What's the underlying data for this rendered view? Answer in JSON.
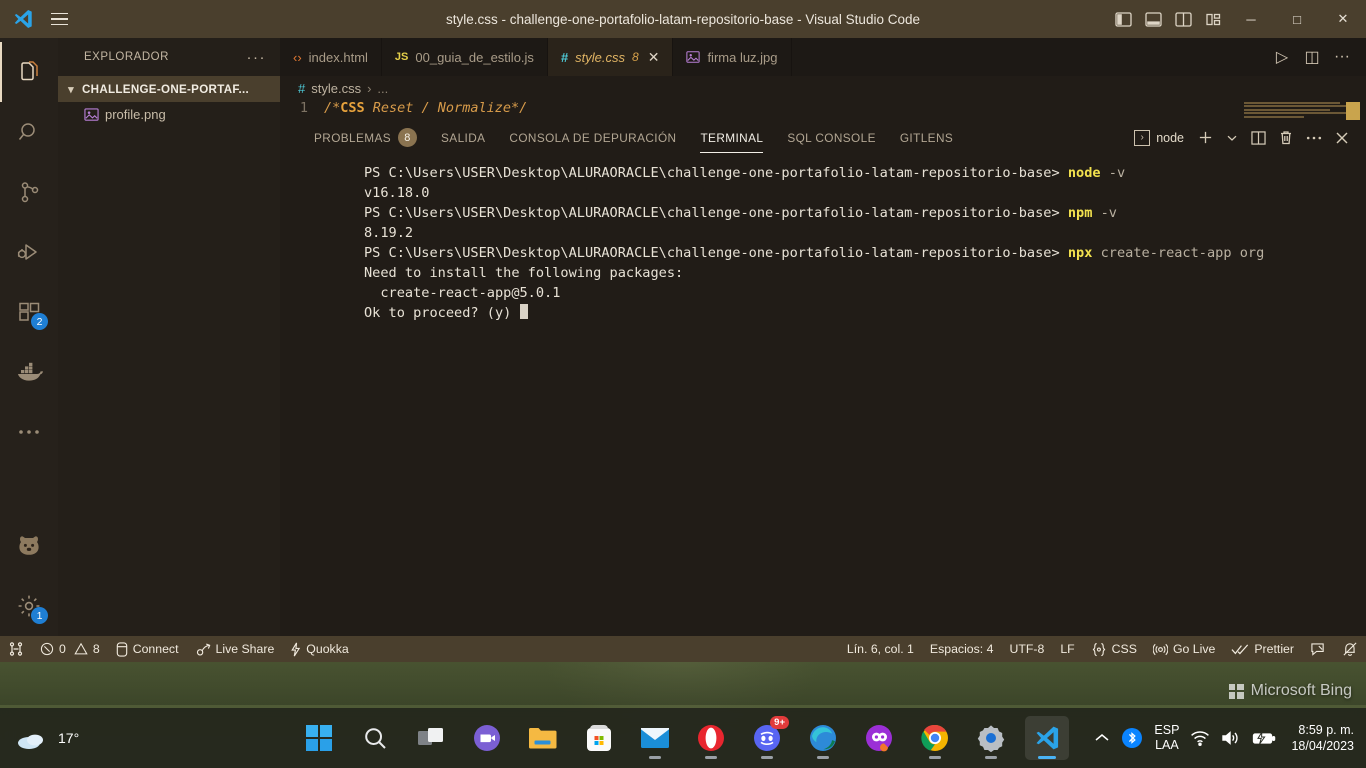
{
  "window": {
    "title": "style.css - challenge-one-portafolio-latam-repositorio-base - Visual Studio Code",
    "logo_name": "vscode-logo",
    "menu_label": "☰",
    "layout_buttons": [
      {
        "name": "toggle-primary-sidebar-icon",
        "label": "primary sidebar"
      },
      {
        "name": "toggle-panel-icon",
        "label": "panel"
      },
      {
        "name": "toggle-secondary-sidebar-icon",
        "label": "secondary sidebar"
      },
      {
        "name": "customize-layout-icon",
        "label": "customize layout"
      }
    ],
    "minimize": "─",
    "maximize": "□",
    "close": "✕"
  },
  "activitybar": {
    "items": [
      {
        "name": "explorer",
        "icon": "files-icon",
        "active": true,
        "badge": ""
      },
      {
        "name": "search",
        "icon": "search-icon",
        "active": false,
        "badge": ""
      },
      {
        "name": "source-control",
        "icon": "source-control-icon",
        "active": false,
        "badge": ""
      },
      {
        "name": "run-and-debug",
        "icon": "run-debug-icon",
        "active": false,
        "badge": ""
      },
      {
        "name": "extensions",
        "icon": "extensions-icon",
        "active": false,
        "badge": "2"
      },
      {
        "name": "docker",
        "icon": "docker-icon",
        "active": false,
        "badge": ""
      },
      {
        "name": "more-views",
        "icon": "ellipsis-icon",
        "active": false,
        "badge": ""
      }
    ],
    "bottom_items": [
      {
        "name": "quokka",
        "icon": "quokka-bear-icon",
        "badge": ""
      },
      {
        "name": "manage-settings",
        "icon": "gear-icon",
        "badge": "1"
      }
    ]
  },
  "sidebar": {
    "title": "EXPLORADOR",
    "more_actions": "···",
    "folder": "CHALLENGE-ONE-PORTAF...",
    "files": [
      {
        "name": "profile.png",
        "icon": "image-file-icon"
      }
    ]
  },
  "editor": {
    "tabs": [
      {
        "label": "index.html",
        "icon": "html-icon",
        "icon_glyph": "‹›",
        "active": false,
        "errors": "",
        "dirty": false
      },
      {
        "label": "00_guia_de_estilo.js",
        "icon": "js-icon",
        "icon_glyph": "JS",
        "active": false,
        "errors": "",
        "dirty": false
      },
      {
        "label": "style.css",
        "icon": "css-icon",
        "icon_glyph": "#",
        "active": true,
        "errors": "8",
        "dirty": false
      },
      {
        "label": "firma luz.jpg",
        "icon": "image-icon",
        "icon_glyph": "▣",
        "active": false,
        "errors": "",
        "dirty": false
      }
    ],
    "tab_actions": [
      {
        "name": "run-file-button",
        "glyph": "▷"
      },
      {
        "name": "split-editor-button",
        "glyph": "◫"
      },
      {
        "name": "more-editor-actions-button",
        "glyph": "···"
      }
    ],
    "breadcrumb": {
      "hash": "#",
      "file": "style.css",
      "separator": "›",
      "tail": "..."
    },
    "first_line_number": "1",
    "first_line_code_pre": "/*",
    "first_line_code_kw": "CSS",
    "first_line_code_post": " Reset / Normalize*/"
  },
  "panel": {
    "tabs": [
      {
        "label": "PROBLEMAS",
        "badge": "8",
        "active": false
      },
      {
        "label": "SALIDA",
        "badge": "",
        "active": false
      },
      {
        "label": "CONSOLA DE DEPURACIÓN",
        "badge": "",
        "active": false
      },
      {
        "label": "TERMINAL",
        "badge": "",
        "active": true
      },
      {
        "label": "SQL CONSOLE",
        "badge": "",
        "active": false
      },
      {
        "label": "GITLENS",
        "badge": "",
        "active": false
      }
    ],
    "terminal_selector": "node",
    "actions": [
      {
        "name": "new-terminal-button",
        "glyph": "＋"
      },
      {
        "name": "terminal-dropdown-button",
        "glyph": "⌄"
      },
      {
        "name": "split-terminal-button",
        "glyph": "◫"
      },
      {
        "name": "kill-terminal-button",
        "glyph": "🗑"
      },
      {
        "name": "panel-more-actions-button",
        "glyph": "···"
      },
      {
        "name": "close-panel-button",
        "glyph": "✕"
      }
    ]
  },
  "terminal": {
    "prompt": "PS C:\\Users\\USER\\Desktop\\ALURAORACLE\\challenge-one-portafolio-latam-repositorio-base>",
    "lines": [
      {
        "type": "command",
        "prompt": "PS C:\\Users\\USER\\Desktop\\ALURAORACLE\\challenge-one-portafolio-latam-repositorio-base> ",
        "cmd": "node",
        "args": " -v"
      },
      {
        "type": "output",
        "text": "v16.18.0"
      },
      {
        "type": "command",
        "prompt": "PS C:\\Users\\USER\\Desktop\\ALURAORACLE\\challenge-one-portafolio-latam-repositorio-base> ",
        "cmd": "npm",
        "args": " -v"
      },
      {
        "type": "output",
        "text": "8.19.2"
      },
      {
        "type": "command",
        "prompt": "PS C:\\Users\\USER\\Desktop\\ALURAORACLE\\challenge-one-portafolio-latam-repositorio-base> ",
        "cmd": "npx",
        "args": " create-react-app org"
      },
      {
        "type": "output",
        "text": "Need to install the following packages:"
      },
      {
        "type": "output",
        "text": "  create-react-app@5.0.1"
      },
      {
        "type": "prompt-input",
        "text": "Ok to proceed? (y) "
      }
    ]
  },
  "statusbar": {
    "left": [
      {
        "name": "remote-window",
        "icon": "remote-icon",
        "label": ""
      },
      {
        "name": "problems",
        "icon": "error-warning-icon",
        "label": "0",
        "label2": "8"
      },
      {
        "name": "connect",
        "icon": "database-icon",
        "label": "Connect"
      },
      {
        "name": "live-share",
        "icon": "live-share-icon",
        "label": "Live Share"
      },
      {
        "name": "quokka",
        "icon": "bolt-icon",
        "label": "Quokka"
      }
    ],
    "right": [
      {
        "name": "cursor-position",
        "label": "Lín. 6, col. 1"
      },
      {
        "name": "indentation",
        "label": "Espacios: 4"
      },
      {
        "name": "encoding",
        "label": "UTF-8"
      },
      {
        "name": "end-of-line",
        "label": "LF"
      },
      {
        "name": "language-mode",
        "icon": "css-brace-icon",
        "label": "CSS"
      },
      {
        "name": "go-live",
        "icon": "broadcast-icon",
        "label": "Go Live"
      },
      {
        "name": "prettier",
        "icon": "check-check-icon",
        "label": "Prettier"
      },
      {
        "name": "feedback",
        "icon": "feedback-icon",
        "label": ""
      },
      {
        "name": "notifications",
        "icon": "bell-dot-icon",
        "label": ""
      }
    ]
  },
  "taskbar": {
    "weather": {
      "temp": "17°",
      "icon": "cloud-icon"
    },
    "apps": [
      {
        "name": "start-button",
        "icon": "windows-logo-icon",
        "running": false,
        "badge": ""
      },
      {
        "name": "taskbar-search",
        "icon": "search-icon",
        "running": false,
        "badge": ""
      },
      {
        "name": "task-view",
        "icon": "task-view-icon",
        "running": false,
        "badge": ""
      },
      {
        "name": "teams-chat",
        "icon": "chat-video-icon",
        "running": false,
        "badge": ""
      },
      {
        "name": "file-explorer",
        "icon": "folder-icon",
        "running": false,
        "badge": ""
      },
      {
        "name": "microsoft-store",
        "icon": "store-icon",
        "running": false,
        "badge": ""
      },
      {
        "name": "mail",
        "icon": "mail-icon",
        "running": true,
        "badge": ""
      },
      {
        "name": "opera",
        "icon": "opera-icon",
        "running": true,
        "badge": ""
      },
      {
        "name": "discord",
        "icon": "discord-icon",
        "running": true,
        "badge": "9+"
      },
      {
        "name": "microsoft-edge",
        "icon": "edge-icon",
        "running": true,
        "badge": ""
      },
      {
        "name": "figma",
        "icon": "figma-icon",
        "running": false,
        "badge": ""
      },
      {
        "name": "google-chrome",
        "icon": "chrome-icon",
        "running": true,
        "badge": ""
      },
      {
        "name": "settings",
        "icon": "gear-icon",
        "running": true,
        "badge": ""
      },
      {
        "name": "visual-studio-code",
        "icon": "vscode-icon",
        "running": true,
        "badge": "",
        "active": true
      }
    ],
    "tray": {
      "chevron": "⌃",
      "bluetooth": "bluetooth-icon",
      "lang_line1": "ESP",
      "lang_line2": "LAA",
      "wifi": "wifi-icon",
      "volume": "volume-icon",
      "battery": "battery-charging-icon",
      "time": "8:59 p. m.",
      "date": "18/04/2023"
    }
  },
  "wallpaper": {
    "watermark": "Microsoft Bing"
  },
  "colors": {
    "titlebar": "#4a3f2d",
    "accent": "#e0b464",
    "badge_blue": "#1f7fd4",
    "terminal_cmd": "#f2e14e",
    "editor_bg": "#211c17"
  }
}
